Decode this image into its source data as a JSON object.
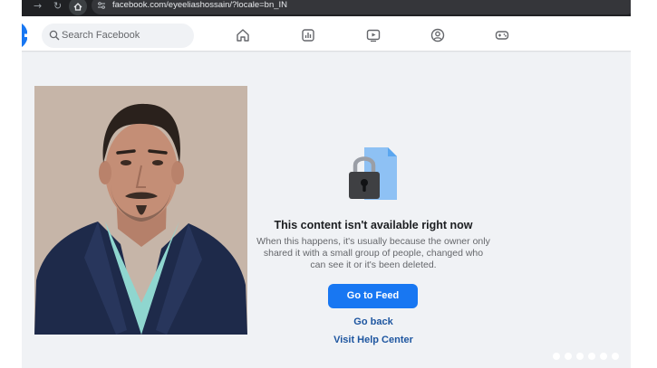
{
  "browser": {
    "url": "facebook.com/eyeeliashossain/?locale=bn_IN",
    "back_glyph": "←",
    "forward_glyph": "→",
    "reload_glyph": "↻"
  },
  "header": {
    "logo": "facebook-logo",
    "search_placeholder": "Search Facebook",
    "nav_icons": [
      "home-icon",
      "video-icon",
      "watch-icon",
      "groups-icon",
      "gaming-icon"
    ]
  },
  "error": {
    "title": "This content isn't available right now",
    "body": "When this happens, it's usually because the owner only shared it with a small group of people, changed who can see it or it's been deleted.",
    "primary_button": "Go to Feed",
    "go_back_label": "Go back",
    "help_label": "Visit Help Center"
  },
  "colors": {
    "brand_blue": "#1877f2",
    "link_blue": "#1e56a0",
    "page_bg": "#f0f2f5"
  }
}
